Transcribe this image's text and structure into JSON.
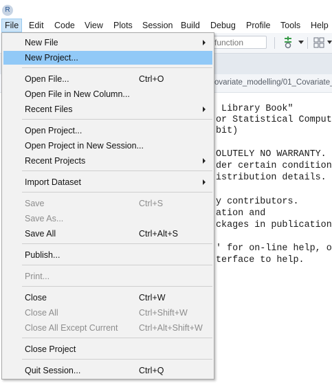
{
  "app": {
    "logo_letter": "R"
  },
  "menubar": [
    "File",
    "Edit",
    "Code",
    "View",
    "Plots",
    "Session",
    "Build",
    "Debug",
    "Profile",
    "Tools",
    "Help"
  ],
  "toolbar": {
    "search_placeholder": "function",
    "search_value": ""
  },
  "pathbar": {
    "path": "ovariate_modelling/01_Covariate_"
  },
  "console_lines": [
    " Library Book\"",
    "or Statistical Comput",
    "bit)",
    "",
    "OLUTELY NO WARRANTY.",
    "der certain condition",
    "istribution details.",
    "",
    "y contributors.",
    "ation and",
    "ckages in publication",
    "",
    "' for on-line help, o",
    "terface to help."
  ],
  "file_menu": {
    "items": [
      {
        "label": "New File",
        "submenu": true
      },
      {
        "label": "New Project...",
        "highlighted": true
      },
      {
        "label": "Open File...",
        "shortcut": "Ctrl+O"
      },
      {
        "label": "Open File in New Column..."
      },
      {
        "label": "Recent Files",
        "submenu": true
      },
      {
        "label": "Open Project..."
      },
      {
        "label": "Open Project in New Session..."
      },
      {
        "label": "Recent Projects",
        "submenu": true
      },
      {
        "label": "Import Dataset",
        "submenu": true
      },
      {
        "label": "Save",
        "shortcut": "Ctrl+S",
        "disabled": true
      },
      {
        "label": "Save As...",
        "disabled": true
      },
      {
        "label": "Save All",
        "shortcut": "Ctrl+Alt+S"
      },
      {
        "label": "Publish..."
      },
      {
        "label": "Print...",
        "disabled": true
      },
      {
        "label": "Close",
        "shortcut": "Ctrl+W"
      },
      {
        "label": "Close All",
        "shortcut": "Ctrl+Shift+W",
        "disabled": true
      },
      {
        "label": "Close All Except Current",
        "shortcut": "Ctrl+Alt+Shift+W",
        "disabled": true
      },
      {
        "label": "Close Project"
      },
      {
        "label": "Quit Session...",
        "shortcut": "Ctrl+Q"
      }
    ]
  },
  "colors": {
    "menu_highlight": "#91c9f7",
    "active_menu_bg": "#cce4f7",
    "disabled_text": "#8d8d8d",
    "addin_icon": "#3a9d4a"
  },
  "icons": [
    "r-logo-icon",
    "addin-icon",
    "grid-layout-icon",
    "chevron-down-icon",
    "submenu-arrow-icon"
  ]
}
